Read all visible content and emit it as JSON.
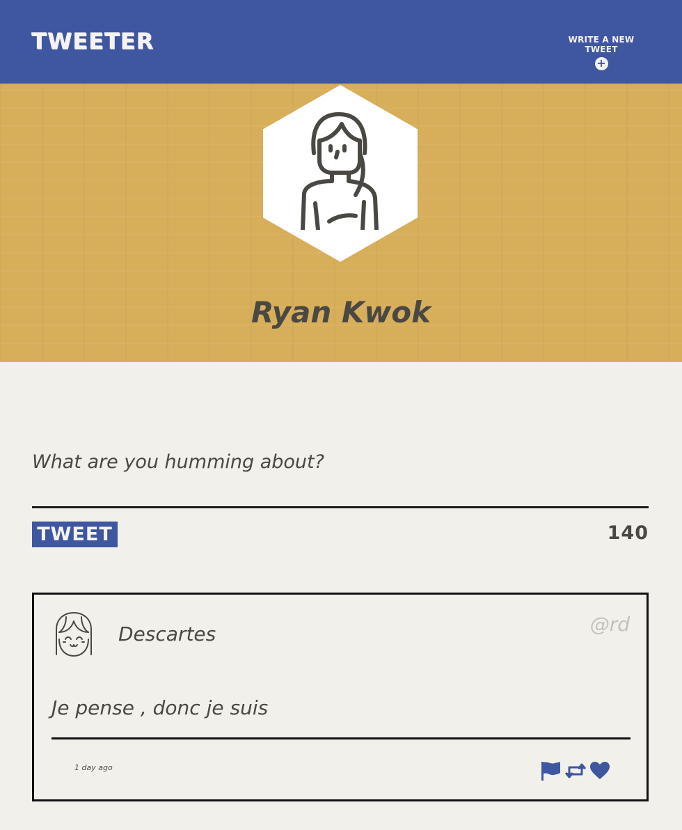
{
  "nav": {
    "brand": "TWEETER",
    "compose_label": "WRITE A NEW TWEET",
    "compose_icon": "plus-circle-icon"
  },
  "profile": {
    "name": "Ryan Kwok",
    "avatar_icon": "woman-avatar-icon"
  },
  "composer": {
    "placeholder": "What are you humming about?",
    "submit_label": "TWEET",
    "char_count": "140"
  },
  "tweets": [
    {
      "name": "Descartes",
      "handle": "@rd",
      "text": "Je pense , donc je suis",
      "time": "1 day ago",
      "avatar_icon": "girl-face-avatar-icon",
      "actions": [
        "flag-icon",
        "retweet-icon",
        "heart-icon"
      ]
    }
  ],
  "colors": {
    "nav_bg": "#3f56a0",
    "hero_bg": "#d7ae5a",
    "page_bg": "#f2f0eb",
    "text": "#4a4843",
    "handle": "#c3c1bc",
    "accent": "#3f56a0"
  }
}
